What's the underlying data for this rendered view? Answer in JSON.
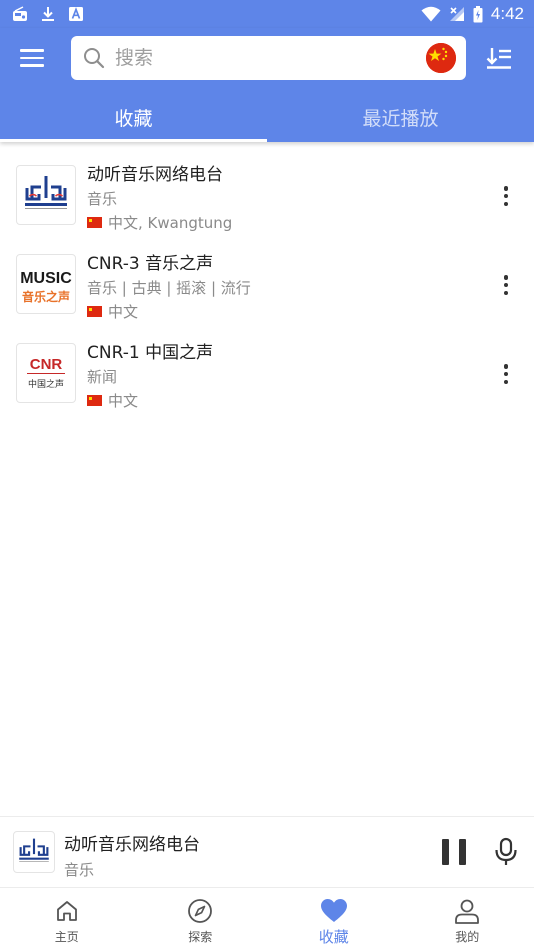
{
  "status_bar": {
    "time": "4:42",
    "left_icons": [
      "radio-icon",
      "download-icon",
      "a-badge-icon"
    ],
    "right_icons": [
      "wifi-icon",
      "signal-icon",
      "battery-icon"
    ]
  },
  "app_bar": {
    "background": "#5e85e8",
    "search": {
      "placeholder": "搜索",
      "value": ""
    },
    "country_flag": "china-flag-icon",
    "tabs": [
      {
        "label": "收藏",
        "active": true
      },
      {
        "label": "最近播放",
        "active": false
      }
    ]
  },
  "stations": [
    {
      "name": "动听音乐网络电台",
      "genres": "音乐",
      "language": "中文, Kwangtung",
      "logo": "dt-radio-logo"
    },
    {
      "name": "CNR-3 音乐之声",
      "genres": "音乐 | 古典 | 摇滚 | 流行",
      "language": "中文",
      "logo": "music-radio-logo",
      "logo_text": {
        "top": "MUSIC",
        "bottom": "音乐之声"
      }
    },
    {
      "name": "CNR-1 中国之声",
      "genres": "新闻",
      "language": "中文",
      "logo": "cnr-logo",
      "logo_text": {
        "top": "CNR",
        "bottom": "中国之声"
      }
    }
  ],
  "player": {
    "title": "动听音乐网络电台",
    "subtitle": "音乐",
    "state": "playing"
  },
  "bottom_nav": {
    "items": [
      {
        "label": "主页",
        "icon": "home-icon",
        "active": false
      },
      {
        "label": "探索",
        "icon": "compass-icon",
        "active": false
      },
      {
        "label": "收藏",
        "icon": "heart-icon",
        "active": true
      },
      {
        "label": "我的",
        "icon": "person-icon",
        "active": false
      }
    ],
    "active_color": "#5e85e8"
  }
}
